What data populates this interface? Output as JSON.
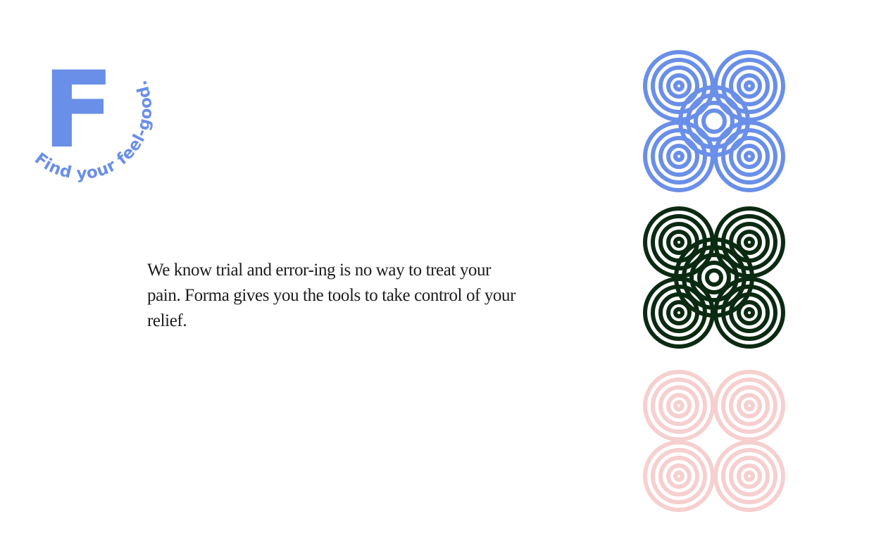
{
  "brand": {
    "letter": "F",
    "tagline": "Find your feel-good.",
    "logo_color": "#6a8fe8"
  },
  "intro": {
    "text": "We know trial and error-ing is no way to treat your pain. Forma gives you the tools to take control of your relief."
  },
  "patterns": [
    {
      "name": "interlocking-rings-blue",
      "color": "#6a8fe8"
    },
    {
      "name": "interlocking-rings-green",
      "color": "#0b2a12"
    },
    {
      "name": "interlocking-rings-pink",
      "color": "#f6cfcf"
    }
  ]
}
